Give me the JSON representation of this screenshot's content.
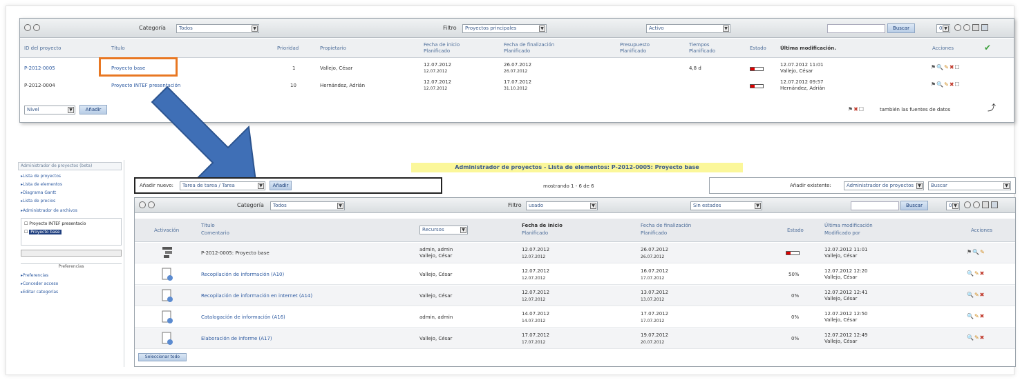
{
  "project_list": {
    "toolbar": {
      "category_label": "Categoría",
      "category_value": "Todos",
      "filter_label": "Filtro",
      "filter_value": "Proyectos principales",
      "status_value": "Activo",
      "search_value": "",
      "search_button": "Buscar",
      "page_size": "0"
    },
    "columns": {
      "id": "ID del proyecto",
      "title": "Título",
      "priority": "Prioridad",
      "owner": "Propietario",
      "start_date": "Fecha de inicio",
      "start_sub": "Planificado",
      "end_date": "Fecha de finalización",
      "end_sub": "Planificado",
      "budget": "Presupuesto",
      "budget_sub": "Planificado",
      "time": "Tiempos",
      "time_sub": "Planificado",
      "state": "Estado",
      "last_mod": "Última modificación.",
      "actions": "Acciones"
    },
    "rows": [
      {
        "id": "P-2012-0005",
        "title": "Proyecto base",
        "priority": "1",
        "owner": "Vallejo, César",
        "start": "12.07.2012",
        "start_sub": "12.07.2012",
        "end": "26.07.2012",
        "end_sub": "26.07.2012",
        "budget": "",
        "time": "4,8 d",
        "last_mod_date": "12.07.2012 11:01",
        "last_mod_user": "Vallejo, César"
      },
      {
        "id": "P-2012-0004",
        "title": "Proyecto INTEF presentación",
        "priority": "10",
        "owner": "Hernández, Adrián",
        "start": "12.07.2012",
        "start_sub": "12.07.2012",
        "end": "17.07.2012",
        "end_sub": "31.10.2012",
        "budget": "",
        "time": "",
        "last_mod_date": "12.07.2012 09:57",
        "last_mod_user": "Hernández, Adrián"
      }
    ],
    "footer": {
      "new_select": "Nivel",
      "add_button": "Añadir",
      "sources_label": "también las fuentes de datos"
    }
  },
  "element_list": {
    "title": "Administrador de proyectos - Lista de elementos: P-2012-0005: Proyecto base",
    "add_new_label": "Añadir nuevo:",
    "add_new_value": "Tarea de tarea / Tarea",
    "add_new_button": "Añadir",
    "showing": "mostrando 1 - 6 de 6",
    "add_existing_label": "Añadir existente:",
    "add_existing_value": "Administrador de proyectos",
    "add_existing_search": "Buscar",
    "toolbar": {
      "category_label": "Categoría",
      "category_value": "Todos",
      "filter_label": "Filtro",
      "filter_value": "usado",
      "status_value": "Sin estados",
      "search_button": "Buscar",
      "page_size": "0"
    },
    "columns": {
      "action": "Activación",
      "title": "Título",
      "comment": "Comentario",
      "resource": "Recursos",
      "start": "Fecha de inicio",
      "start_sub": "Planificado",
      "end": "Fecha de finalización",
      "end_sub": "Planificado",
      "state": "Estado",
      "last_mod": "Última modificación",
      "last_mod_sub": "Modificado por",
      "actions": "Acciones"
    },
    "rows": [
      {
        "title": "P-2012-0005: Proyecto base",
        "resource1": "admin, admin",
        "resource2": "Vallejo, César",
        "start": "12.07.2012",
        "start_sub": "12.07.2012",
        "end": "26.07.2012",
        "end_sub": "26.07.2012",
        "state": "",
        "mod_date": "12.07.2012 11:01",
        "mod_user": "Vallejo, César"
      },
      {
        "title": "Recopilación de información (A10)",
        "resource1": "Vallejo, César",
        "resource2": "",
        "start": "12.07.2012",
        "start_sub": "12.07.2012",
        "end": "16.07.2012",
        "end_sub": "17.07.2012",
        "state": "50%",
        "mod_date": "12.07.2012 12:20",
        "mod_user": "Vallejo, César"
      },
      {
        "title": "Recopilación de información en internet (A14)",
        "resource1": "Vallejo, César",
        "resource2": "",
        "start": "12.07.2012",
        "start_sub": "12.07.2012",
        "end": "13.07.2012",
        "end_sub": "13.07.2012",
        "state": "0%",
        "mod_date": "12.07.2012 12:41",
        "mod_user": "Vallejo, César"
      },
      {
        "title": "Catalogación de información (A16)",
        "resource1": "admin, admin",
        "resource2": "",
        "start": "14.07.2012",
        "start_sub": "14.07.2012",
        "end": "17.07.2012",
        "end_sub": "17.07.2012",
        "state": "0%",
        "mod_date": "12.07.2012 12:50",
        "mod_user": "Vallejo, César"
      },
      {
        "title": "Elaboración de informe (A17)",
        "resource1": "Vallejo, César",
        "resource2": "",
        "start": "17.07.2012",
        "start_sub": "17.07.2012",
        "end": "19.07.2012",
        "end_sub": "20.07.2012",
        "state": "0%",
        "mod_date": "12.07.2012 12:49",
        "mod_user": "Vallejo, César"
      }
    ],
    "remove_button": "Seleccionar todo"
  },
  "sidebar": {
    "title": "Administrador de proyectos (beta)",
    "links": [
      "Lista de proyectos",
      "Lista de elementos",
      "Diagrama Gantt",
      "Lista de precios"
    ],
    "manager_label": "Administrador de archivos",
    "tree": [
      "Proyecto INTEF presentacio",
      "Proyecto base"
    ],
    "section_label": "Preferencias",
    "pref_links": [
      "Preferencias",
      "Conceder acceso",
      "Editar categorías"
    ]
  },
  "colors": {
    "highlight_box": "#e87722",
    "arrow_fill": "#3f6fb6",
    "title_highlight": "#fbf79a",
    "link": "#2d5aa0"
  }
}
